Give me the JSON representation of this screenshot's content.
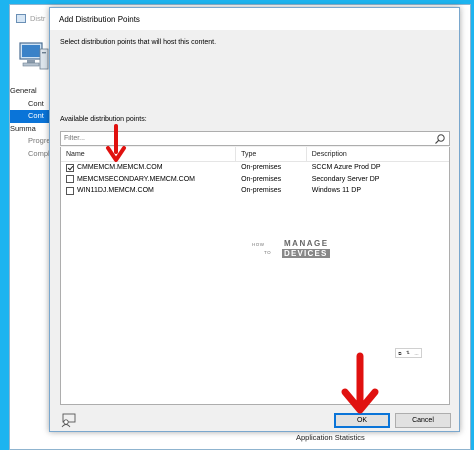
{
  "background_window": {
    "title": "Distr",
    "nav": [
      {
        "label": "General",
        "state": "normal"
      },
      {
        "label": "Cont",
        "state": "indent"
      },
      {
        "label": "Cont",
        "state": "active"
      },
      {
        "label": "Summa",
        "state": "normal"
      },
      {
        "label": "Progres",
        "state": "dim"
      },
      {
        "label": "Comple",
        "state": "dim"
      }
    ],
    "footer_text": "Application Statistics"
  },
  "dialog": {
    "title": "Add Distribution Points",
    "instruction": "Select distribution points that will host this content.",
    "available_label": "Available distribution points:",
    "filter_placeholder": "Filter...",
    "columns": {
      "name": "Name",
      "type": "Type",
      "description": "Description"
    },
    "rows": [
      {
        "name": "CMMEMCM.MEMCM.COM",
        "type": "On-premises",
        "description": "SCCM Azure Prod DP",
        "checked": true
      },
      {
        "name": "MEMCMSECONDARY.MEMCM.COM",
        "type": "On-premises",
        "description": "Secondary Server DP",
        "checked": false
      },
      {
        "name": "WIN11DJ.MEMCM.COM",
        "type": "On-premises",
        "description": "Windows 11 DP",
        "checked": false
      }
    ],
    "buttons": {
      "ok": "OK",
      "cancel": "Cancel"
    }
  },
  "watermark": {
    "how": "HOW",
    "to": "TO",
    "manage": "MANAGE",
    "devices": "DEVICES"
  },
  "colors": {
    "arrow": "#e0110f",
    "accent": "#0a74d8",
    "desktop": "#1db4f0"
  },
  "icons": [
    "computer-icon",
    "search-icon",
    "checkbox-icon",
    "user-feedback-icon",
    "red-arrow-icon"
  ]
}
